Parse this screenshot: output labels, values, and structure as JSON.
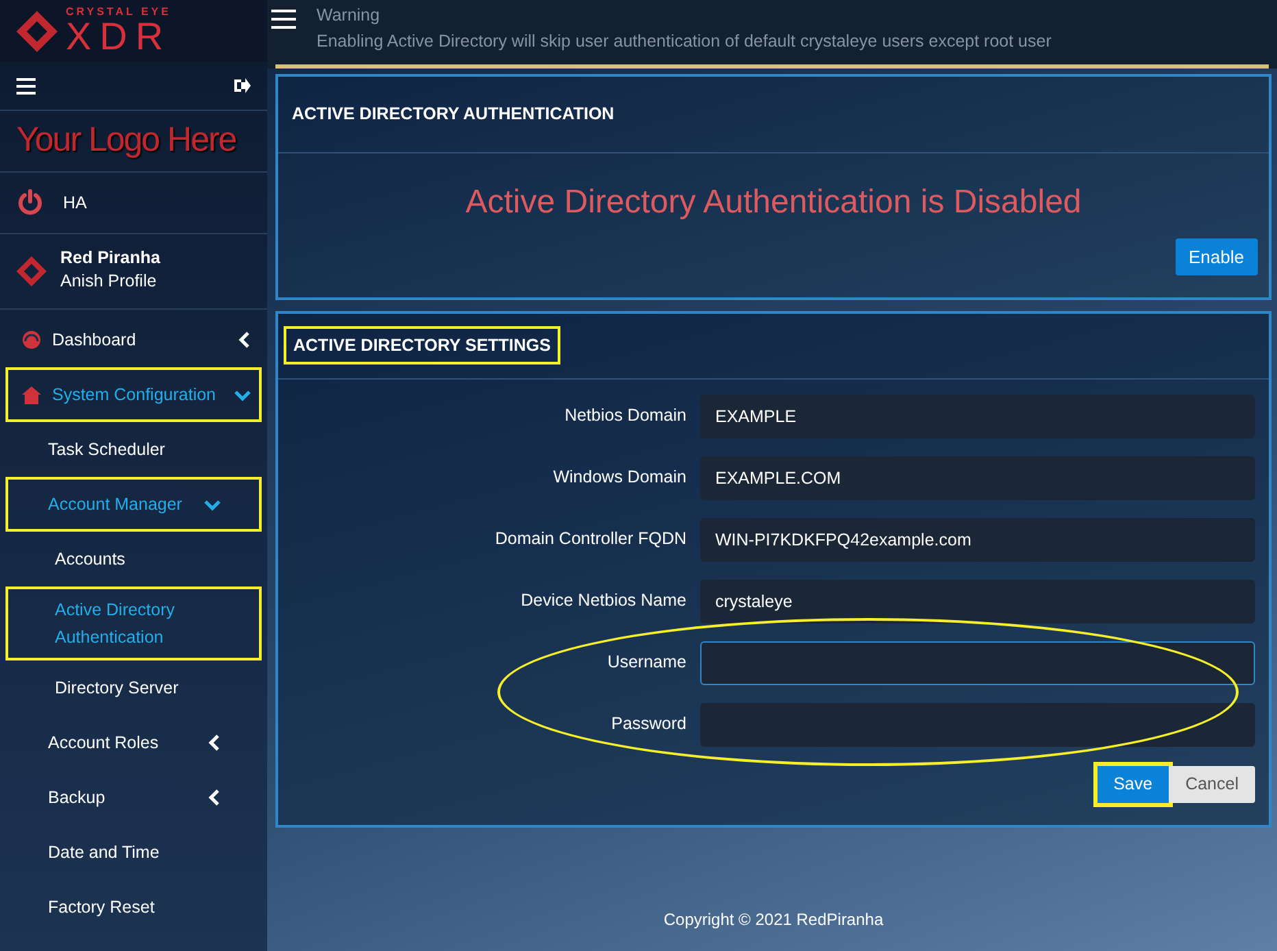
{
  "brand": {
    "tagline": "CRYSTAL EYE",
    "name": "XDR"
  },
  "warning": {
    "title": "Warning",
    "message": "Enabling Active Directory will skip user authentication of default crystaleye users except root user"
  },
  "sidebar": {
    "logo_text": "Your Logo Here",
    "ha_label": "HA",
    "profile": {
      "name": "Red Piranha",
      "subtitle": "Anish Profile"
    },
    "items": [
      {
        "label": "Dashboard",
        "kind": "gauge",
        "expanded": false,
        "selected": false,
        "highlighted": false
      },
      {
        "label": "System Configuration",
        "kind": "home",
        "expanded": true,
        "selected": true,
        "highlighted": true,
        "children": [
          {
            "label": "Task Scheduler",
            "selected": false,
            "highlighted": false
          },
          {
            "label": "Account Manager",
            "expanded": true,
            "selected": true,
            "highlighted": true,
            "children": [
              {
                "label": "Accounts",
                "selected": false,
                "highlighted": false
              },
              {
                "label": "Active Directory Authentication",
                "selected": true,
                "highlighted": true
              },
              {
                "label": "Directory Server",
                "selected": false,
                "highlighted": false
              }
            ]
          },
          {
            "label": "Account Roles",
            "expanded": false,
            "selected": false,
            "highlighted": false
          },
          {
            "label": "Backup",
            "expanded": false,
            "selected": false,
            "highlighted": false
          },
          {
            "label": "Date and Time",
            "selected": false,
            "highlighted": false
          },
          {
            "label": "Factory Reset",
            "selected": false,
            "highlighted": false
          }
        ]
      }
    ]
  },
  "auth_card": {
    "title": "ACTIVE DIRECTORY AUTHENTICATION",
    "status": "Active Directory Authentication is Disabled",
    "button": "Enable"
  },
  "settings_card": {
    "title": "ACTIVE DIRECTORY SETTINGS",
    "title_highlighted": true,
    "fields": [
      {
        "label": "Netbios Domain",
        "value": "EXAMPLE",
        "focused": false,
        "circled": false
      },
      {
        "label": "Windows Domain",
        "value": "EXAMPLE.COM",
        "focused": false,
        "circled": false
      },
      {
        "label": "Domain Controller FQDN",
        "value": "WIN-PI7KDKFPQ42example.com",
        "focused": false,
        "circled": false
      },
      {
        "label": "Device Netbios Name",
        "value": "crystaleye",
        "focused": false,
        "circled": false
      },
      {
        "label": "Username",
        "focused": true,
        "circled": true
      },
      {
        "label": "Password",
        "focused": false,
        "circled": true
      }
    ],
    "save": {
      "label": "Save",
      "highlighted": true
    },
    "cancel": "Cancel"
  },
  "footer": "Copyright © 2021 RedPiranha"
}
